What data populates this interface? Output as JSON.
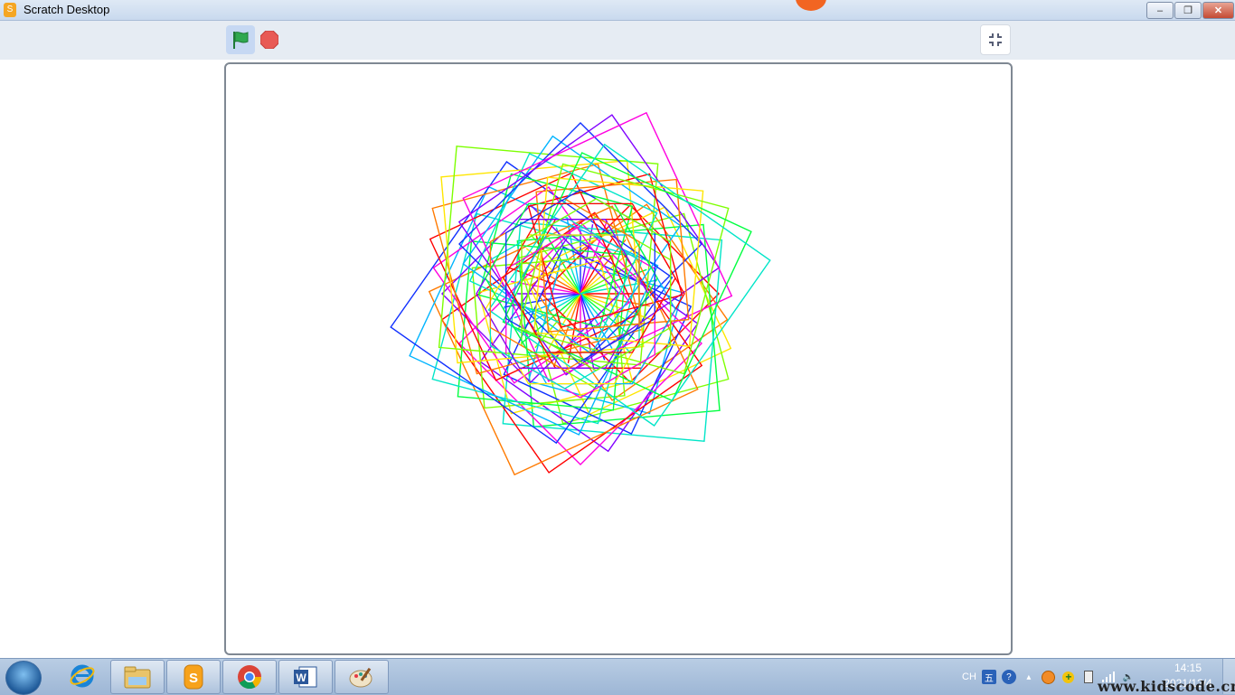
{
  "window": {
    "title": "Scratch Desktop"
  },
  "window_controls": {
    "minimize": "–",
    "maximize": "❐",
    "close": "✕"
  },
  "toolbar": {
    "green_flag": "green-flag-icon",
    "stop": "stop-icon",
    "fullscreen": "unfullscreen-icon",
    "colors": {
      "flag": "#2fa84f",
      "stop": "#e85a55"
    }
  },
  "stage": {
    "drawing": "rainbow-square-spiral-art",
    "spiral": {
      "rings": 36,
      "base": 98,
      "step": 3,
      "turn_deg": 10
    },
    "spokes": 36
  },
  "taskbar": {
    "apps": [
      "ie-icon",
      "explorer-icon",
      "scratch-icon",
      "chrome-icon",
      "word-icon",
      "paint-icon"
    ],
    "tray": {
      "lang": "CH",
      "ime": "五",
      "help": "?"
    },
    "clock": {
      "time": "14:15",
      "date": "2021/12/4"
    }
  },
  "watermark": "www.kidscode.cn"
}
